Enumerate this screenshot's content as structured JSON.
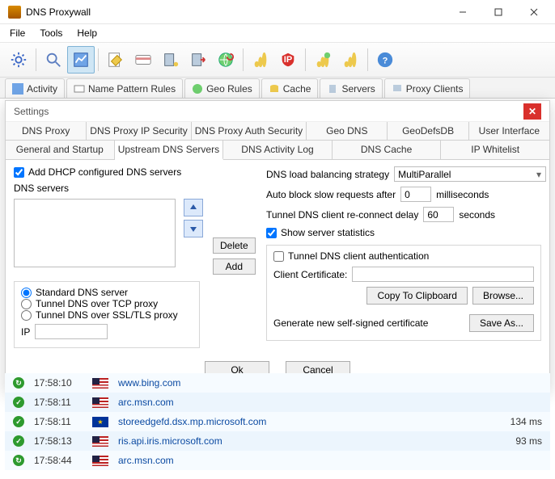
{
  "window": {
    "title": "DNS Proxywall"
  },
  "menu": {
    "file": "File",
    "tools": "Tools",
    "help": "Help"
  },
  "outer_tabs": {
    "activity": "Activity",
    "name_rules": "Name Pattern Rules",
    "geo_rules": "Geo Rules",
    "cache": "Cache",
    "servers": "Servers",
    "proxy_clients": "Proxy Clients"
  },
  "dialog": {
    "title": "Settings",
    "tabs_row1": {
      "dns_proxy": "DNS Proxy",
      "ip_sec": "DNS Proxy IP Security",
      "auth_sec": "DNS Proxy Auth Security",
      "geo_dns": "Geo DNS",
      "geodb": "GeoDefsDB",
      "ui": "User Interface"
    },
    "tabs_row2": {
      "general": "General and Startup",
      "upstream": "Upstream DNS Servers",
      "activity_log": "DNS Activity Log",
      "cache": "DNS Cache",
      "ip_whitelist": "IP Whitelist"
    },
    "left": {
      "add_dhcp": "Add DHCP configured DNS servers",
      "dns_servers_label": "DNS servers",
      "delete_btn": "Delete",
      "add_btn": "Add",
      "radio_standard": "Standard DNS server",
      "radio_tcp": "Tunnel DNS over TCP proxy",
      "radio_ssl": "Tunnel DNS over SSL/TLS proxy",
      "ip_label": "IP",
      "ip_value": ""
    },
    "right": {
      "lb_label": "DNS load balancing strategy",
      "lb_value": "MultiParallel",
      "autoblock_label": "Auto block slow requests after",
      "autoblock_value": "0",
      "autoblock_unit": "milliseconds",
      "reconnect_label": "Tunnel DNS client re-connect delay",
      "reconnect_value": "60",
      "reconnect_unit": "seconds",
      "show_stats": "Show server statistics",
      "tunnel_auth": "Tunnel DNS client authentication",
      "client_cert": "Client Certificate:",
      "copy_btn": "Copy To Clipboard",
      "browse_btn": "Browse...",
      "gen_cert": "Generate new self-signed certificate",
      "save_as": "Save As..."
    },
    "ok": "Ok",
    "cancel": "Cancel"
  },
  "log": [
    {
      "status": "rec",
      "time": "17:58:10",
      "flag": "us",
      "domain": "www.bing.com",
      "ms": ""
    },
    {
      "status": "ok",
      "time": "17:58:11",
      "flag": "us",
      "domain": "arc.msn.com",
      "ms": ""
    },
    {
      "status": "ok",
      "time": "17:58:11",
      "flag": "eu",
      "domain": "storeedgefd.dsx.mp.microsoft.com",
      "ms": "134 ms"
    },
    {
      "status": "ok",
      "time": "17:58:13",
      "flag": "us",
      "domain": "ris.api.iris.microsoft.com",
      "ms": "93 ms"
    },
    {
      "status": "rec",
      "time": "17:58:44",
      "flag": "us",
      "domain": "arc.msn.com",
      "ms": ""
    }
  ]
}
